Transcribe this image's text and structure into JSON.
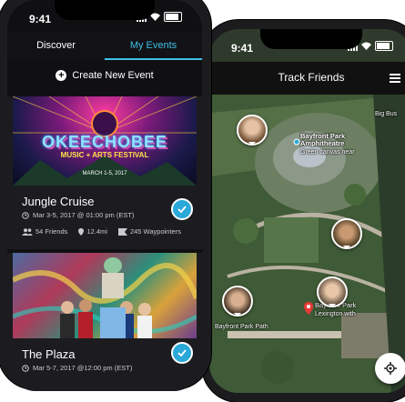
{
  "status": {
    "time": "9:41"
  },
  "events_screen": {
    "tabs": [
      {
        "label": "Discover"
      },
      {
        "label": "My Events"
      }
    ],
    "create_label": "Create New Event",
    "events": [
      {
        "image_brand": "OKEECHOBEE",
        "image_subtitle": "MUSIC + ARTS FESTIVAL",
        "image_date": "MARCH 1-5, 2017",
        "title": "Jungle Cruise",
        "date": "Mar 3-5, 2017 @ 01:00 pm (EST)",
        "friends": "54 Friends",
        "distance": "12.4mi",
        "waypoints": "245 Waypointers",
        "selected": true
      },
      {
        "title": "The Plaza",
        "date": "Mar 5-7, 2017 @12:00 pm (EST)",
        "selected": true
      }
    ]
  },
  "map_screen": {
    "title": "Track Friends",
    "labels": {
      "amphitheatre": "Bayfront Park\nAmphitheatre",
      "amphitheatre_sub": "Green canvas near",
      "big_bus": "Big Bus",
      "bayfront_park": "Bayfront Park",
      "bayfront_park_sub": "Lexington with",
      "bayfront_park_path": "Bayfront Park Path"
    }
  },
  "colors": {
    "accent": "#3ec0e6",
    "check": "#2aa8d8"
  }
}
